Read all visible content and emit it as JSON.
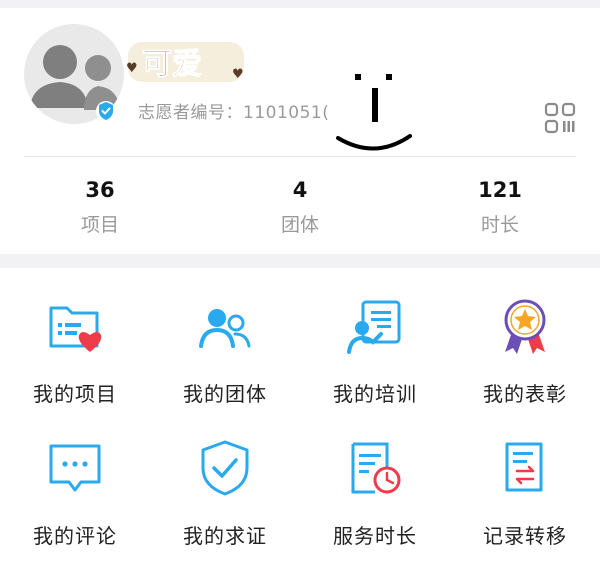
{
  "profile": {
    "nickname": "可爱",
    "volunteer_id_label": "志愿者编号：",
    "volunteer_id_value": "1101051(",
    "verified_icon": "verified-badge-icon",
    "qr_icon": "qr-code-icon"
  },
  "stats": [
    {
      "value": "36",
      "label": "项目"
    },
    {
      "value": "4",
      "label": "团体"
    },
    {
      "value": "121",
      "label": "时长"
    }
  ],
  "menu": [
    {
      "label": "我的项目",
      "icon": "project-folder-heart-icon"
    },
    {
      "label": "我的团体",
      "icon": "group-people-icon"
    },
    {
      "label": "我的培训",
      "icon": "training-board-icon"
    },
    {
      "label": "我的表彰",
      "icon": "award-medal-icon"
    },
    {
      "label": "我的评论",
      "icon": "comment-bubble-icon"
    },
    {
      "label": "我的求证",
      "icon": "verify-shield-icon"
    },
    {
      "label": "服务时长",
      "icon": "service-time-doc-icon"
    },
    {
      "label": "记录转移",
      "icon": "record-transfer-icon"
    }
  ],
  "colors": {
    "accent_blue": "#29a9ee",
    "heart_red": "#ef3c4a",
    "medal_orange": "#f6a623",
    "medal_purple": "#6b4fb8",
    "text_gray": "#9a9a9a"
  }
}
